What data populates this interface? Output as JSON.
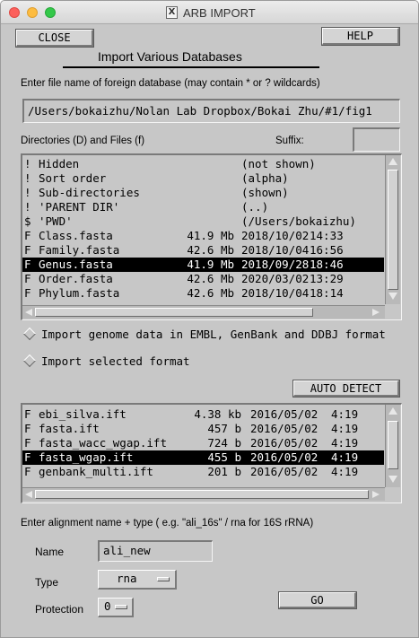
{
  "window": {
    "title": "ARB IMPORT"
  },
  "toolbar": {
    "close_label": "CLOSE",
    "help_label": "HELP"
  },
  "heading": "Import Various Databases",
  "file_prompt": "Enter file name of foreign database (may contain * or ? wildcards)",
  "file_input": {
    "value": "/Users/bokaizhu/Nolan Lab Dropbox/Bokai Zhu/#1/fig1"
  },
  "dirs_label": "Directories (D) and Files (f)",
  "suffix": {
    "label": "Suffix:",
    "value": ""
  },
  "file_list": [
    {
      "flag": "!",
      "name": "Hidden",
      "size": "",
      "date": "(not shown)",
      "time": "",
      "selected": false
    },
    {
      "flag": "!",
      "name": "Sort order",
      "size": "",
      "date": "(alpha)",
      "time": "",
      "selected": false
    },
    {
      "flag": "!",
      "name": "Sub-directories",
      "size": "",
      "date": "(shown)",
      "time": "",
      "selected": false
    },
    {
      "flag": "!",
      "name": "'PARENT DIR'",
      "size": "",
      "date": "(..)",
      "time": "",
      "selected": false
    },
    {
      "flag": "$",
      "name": "'PWD'",
      "size": "",
      "date": "(/Users/bokaizhu)",
      "time": "",
      "selected": false
    },
    {
      "flag": "F",
      "name": "Class.fasta",
      "size": "41.9 Mb",
      "date": "2018/10/02",
      "time": "14:33",
      "selected": false
    },
    {
      "flag": "F",
      "name": "Family.fasta",
      "size": "42.6 Mb",
      "date": "2018/10/04",
      "time": "16:56",
      "selected": false
    },
    {
      "flag": "F",
      "name": "Genus.fasta",
      "size": "41.9 Mb",
      "date": "2018/09/28",
      "time": "18:46",
      "selected": true
    },
    {
      "flag": "F",
      "name": "Order.fasta",
      "size": "42.6 Mb",
      "date": "2020/03/02",
      "time": "13:29",
      "selected": false
    },
    {
      "flag": "F",
      "name": "Phylum.fasta",
      "size": "42.6 Mb",
      "date": "2018/10/04",
      "time": "18:14",
      "selected": false
    }
  ],
  "options": {
    "genome": "Import genome data in EMBL, GenBank and DDBJ format",
    "selected_format": "Import selected format"
  },
  "auto_detect_label": "AUTO DETECT",
  "format_list": [
    {
      "flag": "F",
      "name": "ebi_silva.ift",
      "size": "4.38 kb",
      "date": "2016/05/02",
      "time": "4:19",
      "selected": false
    },
    {
      "flag": "F",
      "name": "fasta.ift",
      "size": "457 b",
      "date": "2016/05/02",
      "time": "4:19",
      "selected": false
    },
    {
      "flag": "F",
      "name": "fasta_wacc_wgap.ift",
      "size": "724 b",
      "date": "2016/05/02",
      "time": "4:19",
      "selected": false
    },
    {
      "flag": "F",
      "name": "fasta_wgap.ift",
      "size": "455 b",
      "date": "2016/05/02",
      "time": "4:19",
      "selected": true
    },
    {
      "flag": "F",
      "name": "genbank_multi.ift",
      "size": "201 b",
      "date": "2016/05/02",
      "time": "4:19",
      "selected": false
    }
  ],
  "alignment_prompt": "Enter alignment name + type ( e.g. \"ali_16s\" / rna  for 16S rRNA)",
  "name_field": {
    "label": "Name",
    "value": "ali_new"
  },
  "type_field": {
    "label": "Type",
    "value": "rna"
  },
  "protection_field": {
    "label": "Protection",
    "value": "0"
  },
  "go_label": "GO"
}
